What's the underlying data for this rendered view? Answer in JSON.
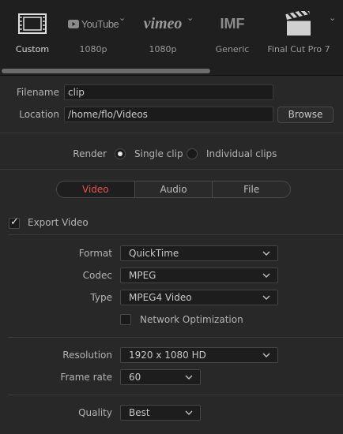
{
  "presets": [
    {
      "label": "Custom",
      "icon": "film-strip-icon"
    },
    {
      "label": "1080p",
      "icon": "youtube-logo-icon",
      "brand": "YouTube"
    },
    {
      "label": "1080p",
      "icon": "vimeo-logo-icon",
      "brand": "vimeo"
    },
    {
      "label": "Generic",
      "icon": "imf-logo-icon",
      "brand": "IMF"
    },
    {
      "label": "Final Cut Pro 7",
      "icon": "clapperboard-icon"
    }
  ],
  "file": {
    "filename_label": "Filename",
    "filename_value": "clip",
    "location_label": "Location",
    "location_value": "/home/flo/Videos",
    "browse_label": "Browse"
  },
  "render": {
    "label": "Render",
    "single_clip": "Single clip",
    "individual_clips": "Individual clips",
    "selected": "single_clip"
  },
  "tabs": [
    "Video",
    "Audio",
    "File"
  ],
  "video": {
    "export_label": "Export Video",
    "export_checked": true,
    "format_label": "Format",
    "format_value": "QuickTime",
    "codec_label": "Codec",
    "codec_value": "MPEG",
    "type_label": "Type",
    "type_value": "MPEG4 Video",
    "network_label": "Network Optimization",
    "network_checked": false,
    "resolution_label": "Resolution",
    "resolution_value": "1920 x 1080 HD",
    "framerate_label": "Frame rate",
    "framerate_value": "60",
    "quality_label": "Quality",
    "quality_value": "Best"
  },
  "colors": {
    "accent": "#e2544f",
    "background": "#282828",
    "field": "#1b1b1b"
  }
}
